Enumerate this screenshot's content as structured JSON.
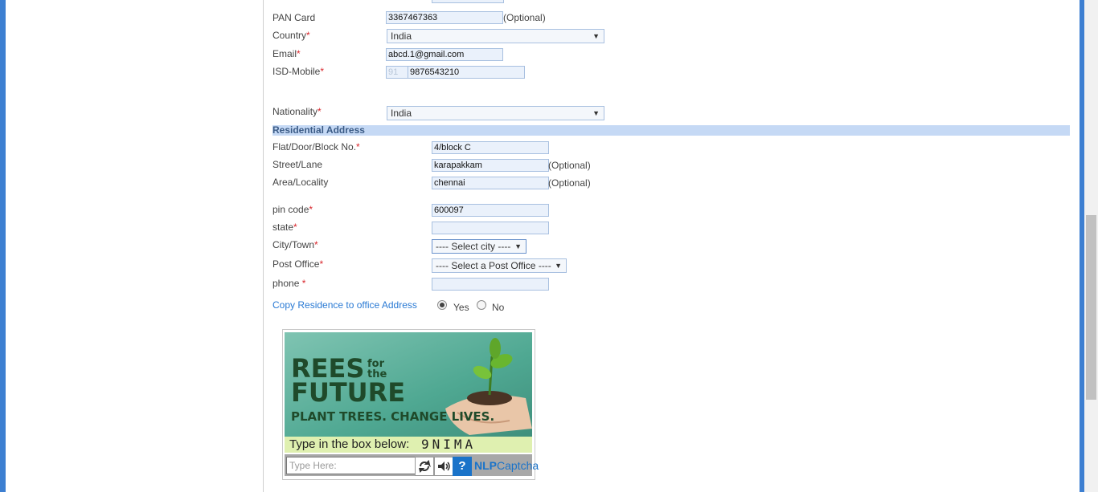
{
  "form": {
    "pan_label": "PAN Card",
    "pan_value": "3367467363",
    "pan_optional": "(Optional)",
    "country_label": "Country",
    "country_value": "India",
    "email_label": "Email",
    "email_value": "abcd.1@gmail.com",
    "isd_label": "ISD-Mobile",
    "isd_code": "91",
    "mobile_value": "9876543210",
    "nationality_label": "Nationality",
    "nationality_value": "India",
    "required_mark": "*"
  },
  "residential": {
    "heading": "Residential Address",
    "flat_label": "Flat/Door/Block No.",
    "flat_value": "4/block C",
    "street_label": "Street/Lane",
    "street_value": "karapakkam",
    "street_optional": "(Optional)",
    "area_label": "Area/Locality",
    "area_value": "chennai",
    "area_optional": "(Optional)",
    "pin_label": "pin code",
    "pin_value": "600097",
    "state_label": "state",
    "state_value": "",
    "city_label": "City/Town",
    "city_value": "---- Select city ----",
    "post_label": "Post Office",
    "post_value": "---- Select a Post Office ----",
    "phone_label": "phone ",
    "phone_value": "",
    "copy_label": "Copy Residence to office Address",
    "copy_yes": "Yes",
    "copy_no": "No",
    "copy_selected": "Yes"
  },
  "captcha": {
    "ad_line1": "REES",
    "ad_for": "for",
    "ad_the": "the",
    "ad_line2": "FUTURE",
    "ad_tagline": "PLANT TREES. CHANGE LIVES.",
    "instruction": "Type in the box below:",
    "code": "9NIMA",
    "input_placeholder": "Type Here:",
    "help_label": "?",
    "brand_nlp": "NLP",
    "brand_captcha": "Captcha"
  },
  "icons": {
    "refresh": "refresh-icon",
    "audio": "speaker-icon",
    "help": "help-icon",
    "dropdown": "chevron-down-icon"
  },
  "colors": {
    "accent": "#3d7fd1",
    "section_bg": "#c5d9f5",
    "required": "#d9262c",
    "link": "#2a7ad4"
  }
}
